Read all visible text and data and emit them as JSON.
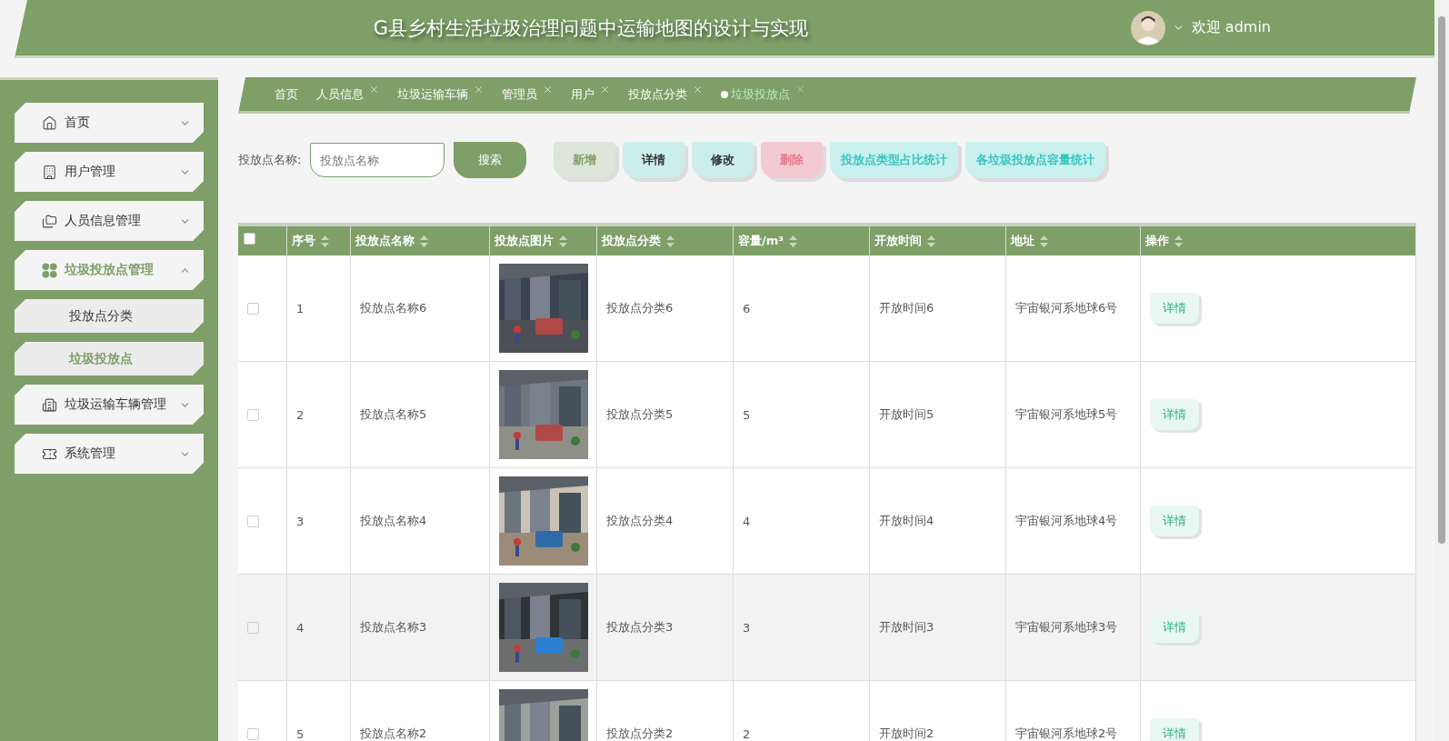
{
  "header": {
    "title": "G县乡村生活垃圾治理问题中运输地图的设计与实现",
    "welcome": "欢迎 admin"
  },
  "sidebar": {
    "items": [
      {
        "label": "首页",
        "expanded": false,
        "selected": false
      },
      {
        "label": "用户管理",
        "expanded": false,
        "selected": false
      },
      {
        "label": "人员信息管理",
        "expanded": false,
        "selected": false
      },
      {
        "label": "垃圾投放点管理",
        "expanded": true,
        "selected": true,
        "children": [
          {
            "label": "投放点分类",
            "selected": false
          },
          {
            "label": "垃圾投放点",
            "selected": true
          }
        ]
      },
      {
        "label": "垃圾运输车辆管理",
        "expanded": false,
        "selected": false
      },
      {
        "label": "系统管理",
        "expanded": false,
        "selected": false
      }
    ]
  },
  "tabs": [
    {
      "label": "首页",
      "closable": false,
      "selected": false
    },
    {
      "label": "人员信息",
      "closable": true,
      "selected": false
    },
    {
      "label": "垃圾运输车辆",
      "closable": true,
      "selected": false
    },
    {
      "label": "管理员",
      "closable": true,
      "selected": false
    },
    {
      "label": "用户",
      "closable": true,
      "selected": false
    },
    {
      "label": "投放点分类",
      "closable": true,
      "selected": false
    },
    {
      "label": "垃圾投放点",
      "closable": true,
      "selected": true
    }
  ],
  "search": {
    "label": "投放点名称:",
    "placeholder": "投放点名称",
    "button": "搜索"
  },
  "actions": [
    {
      "label": "新增",
      "kind": "add"
    },
    {
      "label": "详情",
      "kind": "info"
    },
    {
      "label": "修改",
      "kind": "info"
    },
    {
      "label": "删除",
      "kind": "delete"
    },
    {
      "label": "投放点类型占比统计",
      "kind": "stat"
    },
    {
      "label": "各垃圾投放点容量统计",
      "kind": "stat"
    }
  ],
  "table": {
    "select_all_checked": false,
    "columns": [
      "序号",
      "投放点名称",
      "投放点图片",
      "投放点分类",
      "容量/m³",
      "开放时间",
      "地址",
      "操作"
    ],
    "rows": [
      {
        "index": "1",
        "name": "投放点名称6",
        "category": "投放点分类6",
        "capacity": "6",
        "open_time": "开放时间6",
        "address": "宇宙银河系地球6号",
        "action": "详情",
        "checked": false,
        "hovered": false
      },
      {
        "index": "2",
        "name": "投放点名称5",
        "category": "投放点分类5",
        "capacity": "5",
        "open_time": "开放时间5",
        "address": "宇宙银河系地球5号",
        "action": "详情",
        "checked": false,
        "hovered": false
      },
      {
        "index": "3",
        "name": "投放点名称4",
        "category": "投放点分类4",
        "capacity": "4",
        "open_time": "开放时间4",
        "address": "宇宙银河系地球4号",
        "action": "详情",
        "checked": false,
        "hovered": false
      },
      {
        "index": "4",
        "name": "投放点名称3",
        "category": "投放点分类3",
        "capacity": "3",
        "open_time": "开放时间3",
        "address": "宇宙银河系地球3号",
        "action": "详情",
        "checked": false,
        "hovered": true
      },
      {
        "index": "5",
        "name": "投放点名称2",
        "category": "投放点分类2",
        "capacity": "2",
        "open_time": "开放时间2",
        "address": "宇宙银河系地球2号",
        "action": "详情",
        "checked": false,
        "hovered": false
      }
    ]
  }
}
